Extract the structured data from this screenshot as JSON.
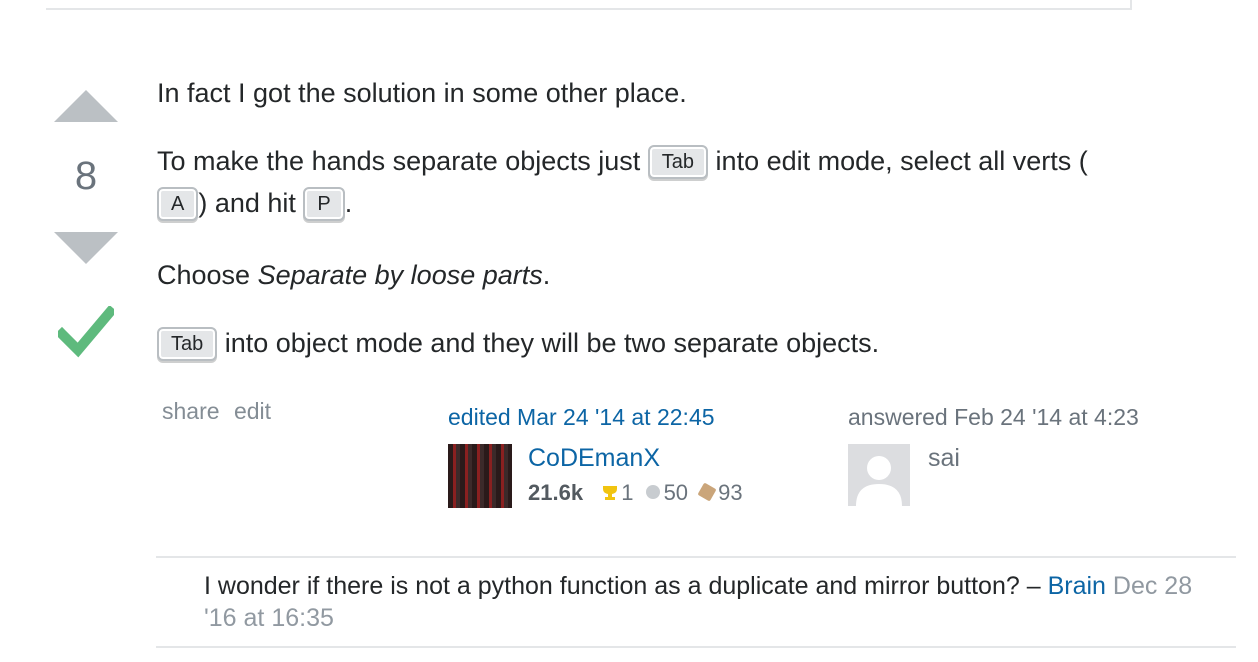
{
  "vote": {
    "count": "8"
  },
  "post": {
    "p1": "In fact I got the solution in some other place.",
    "p2_a": "To make the hands separate objects just ",
    "p2_key1": "Tab",
    "p2_b": " into edit mode, select all verts (",
    "p2_key2": "A",
    "p2_c": ") and hit ",
    "p2_key3": "P",
    "p2_d": ".",
    "p3_a": "Choose ",
    "p3_em": "Separate by loose parts",
    "p3_b": ".",
    "p4_key": "Tab",
    "p4_b": " into object mode and they will be two separate objects."
  },
  "post_menu": {
    "share_label": "share",
    "edit_label": "edit"
  },
  "edited": {
    "label": "edited Mar 24 '14 at 22:45",
    "user_name": "CoDEmanX",
    "reputation": "21.6k",
    "gold": "1",
    "silver": "50",
    "bronze": "93"
  },
  "answered": {
    "label": "answered Feb 24 '14 at 4:23",
    "user_name": "sai"
  },
  "comment": {
    "text": "I wonder if there is not a python function as a duplicate and mirror button? – ",
    "user": "Brain",
    "date": " Dec 28 '16 at 16:35"
  },
  "colors": {
    "accepted": "#5eba7d",
    "link": "#0c65a5",
    "vote_arrow": "#bbc0c4"
  }
}
